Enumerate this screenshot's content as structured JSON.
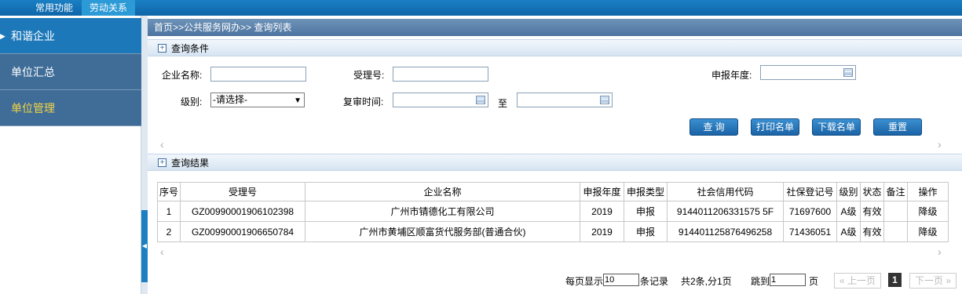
{
  "topnav": {
    "tab1": "常用功能",
    "tab2": "劳动关系"
  },
  "sidebar": {
    "items": [
      {
        "label": "和谐企业"
      },
      {
        "label": "单位汇总"
      },
      {
        "label": "单位管理"
      }
    ]
  },
  "breadcrumb": "首页>>公共服务网办>> 查询列表",
  "query_section": {
    "title": "查询条件",
    "expand": "+"
  },
  "form": {
    "company_label": "企业名称:",
    "company_value": "",
    "accept_label": "受理号:",
    "accept_value": "",
    "year_label": "申报年度:",
    "year_value": "",
    "level_label": "级别:",
    "level_value": "-请选择-",
    "review_label": "复审时间:",
    "review_from": "",
    "to_label": "至",
    "review_to": ""
  },
  "buttons": {
    "query": "查 询",
    "print": "打印名单",
    "download": "下载名单",
    "reset": "重置"
  },
  "results_section": {
    "title": "查询结果",
    "expand": "+"
  },
  "table": {
    "headers": [
      "序号",
      "受理号",
      "企业名称",
      "申报年度",
      "申报类型",
      "社会信用代码",
      "社保登记号",
      "级别",
      "状态",
      "备注",
      "操作"
    ],
    "rows": [
      [
        "1",
        "GZ00990001906102398",
        "广州市锖德化工有限公司",
        "2019",
        "申报",
        "9144011206331575 5F",
        "71697600",
        "A级",
        "有效",
        "",
        "降级"
      ],
      [
        "2",
        "GZ00990001906650784",
        "广州市黄埔区顺富货代服务部(普通合伙)",
        "2019",
        "申报",
        "914401125876496258",
        "71436051",
        "A级",
        "有效",
        "",
        "降级"
      ]
    ]
  },
  "pager": {
    "per_page_prefix": "每页显示",
    "per_page_value": "10",
    "per_page_suffix": "条记录",
    "summary": "共2条,分1页",
    "jump_prefix": "跳到",
    "jump_value": "1",
    "jump_suffix": "页",
    "prev": "« 上一页",
    "current": "1",
    "next": "下一页 »"
  }
}
